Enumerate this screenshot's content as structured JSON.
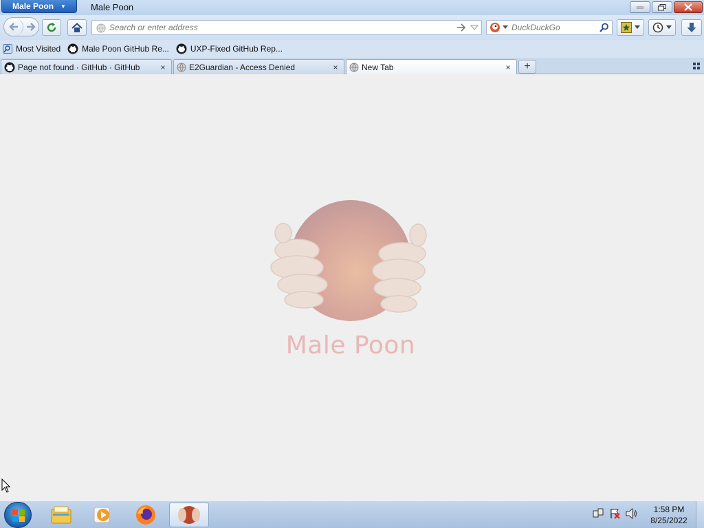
{
  "window": {
    "app_button_label": "Male Poon",
    "title": "Male Poon"
  },
  "navbar": {
    "url_placeholder": "Search or enter address",
    "url_value": "",
    "search_engine": "DuckDuckGo",
    "search_placeholder": "DuckDuckGo"
  },
  "bookmarks": [
    {
      "label": "Most Visited",
      "icon": "most-visited-icon"
    },
    {
      "label": "Male Poon GitHub Re...",
      "icon": "github-icon"
    },
    {
      "label": "UXP-Fixed GitHub Rep...",
      "icon": "github-icon"
    }
  ],
  "tabs": [
    {
      "label": "Page not found · GitHub · GitHub",
      "icon": "github-icon",
      "active": false
    },
    {
      "label": "E2Guardian - Access Denied",
      "icon": "globe-icon",
      "active": false
    },
    {
      "label": "New Tab",
      "icon": "globe-icon",
      "active": true
    }
  ],
  "tab_close_glyph": "×",
  "new_tab_glyph": "+",
  "content": {
    "logo_text": "Male Poon"
  },
  "taskbar": {
    "apps": [
      "windows-explorer-icon",
      "media-player-icon",
      "firefox-icon",
      "male-poon-browser-icon"
    ],
    "clock_time": "1:58 PM",
    "clock_date": "8/25/2022"
  },
  "colors": {
    "accent": "#1f5fb8",
    "logo_text": "#e4686a",
    "page_bg": "#efefef"
  }
}
